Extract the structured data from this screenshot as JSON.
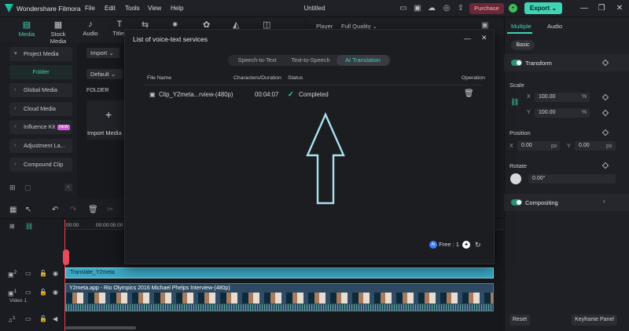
{
  "app": {
    "name": "Wondershare Filmora",
    "menu": [
      "File",
      "Edit",
      "Tools",
      "View",
      "Help"
    ],
    "project_title": "Untitled",
    "purchase_label": "Purchase",
    "export_label": "Export"
  },
  "toolbar": {
    "tabs": [
      {
        "label": "Media",
        "icon": "media-icon",
        "active": true
      },
      {
        "label": "Stock Media",
        "icon": "stock-media-icon"
      },
      {
        "label": "Audio",
        "icon": "music-note-icon"
      },
      {
        "label": "Titles",
        "icon": "titles-icon"
      }
    ]
  },
  "sidebar": {
    "items": [
      {
        "label": "Project Media"
      },
      {
        "label": "Folder"
      },
      {
        "label": "Global Media"
      },
      {
        "label": "Cloud Media"
      },
      {
        "label": "Influence Kit",
        "badge": "NEW"
      },
      {
        "label": "Adjustment La..."
      },
      {
        "label": "Compound Clip"
      }
    ]
  },
  "media": {
    "import_label": "Import",
    "default_label": "Default",
    "folder_label": "FOLDER",
    "import_media_label": "Import Media"
  },
  "player": {
    "label": "Player",
    "quality": "Full Quality"
  },
  "dialog": {
    "title": "List of voice-text services",
    "tabs": [
      "Speech-to-Text",
      "Text-to-Speech",
      "AI Translation"
    ],
    "active_tab": "AI Translation",
    "columns": [
      "File Name",
      "Characters/Duration",
      "Status",
      "Operation"
    ],
    "rows": [
      {
        "file_name": "Clip_Y2meta...rview-(480p)",
        "duration": "00:04:07",
        "status": "Completed"
      }
    ],
    "free_label": "Free : 1",
    "ai_badge": "AI"
  },
  "properties": {
    "tabs": [
      "Multiple",
      "Audio"
    ],
    "active_tab": "Multiple",
    "basic_label": "Basic",
    "transform_label": "Transform",
    "scale_label": "Scale",
    "scale_x": "100.00",
    "scale_y": "100.00",
    "percent": "%",
    "position_label": "Position",
    "pos_x": "0.00",
    "pos_y": "0.00",
    "px": "px",
    "rotate_label": "Rotate",
    "rotate_value": "0.00°",
    "compositing_label": "Compositing",
    "x": "X",
    "y": "Y",
    "reset_label": "Reset",
    "keyframe_label": "Keyframe Panel"
  },
  "timeline": {
    "ruler": [
      "00:00",
      "00:00:05:00"
    ],
    "track2_index": "2",
    "track1_index": "1",
    "video_track_label": "Video 1",
    "audio_track_index": "1",
    "title_clip": "Translate_Y2meta",
    "video_clip": "Y2meta.app - Rio Olympics 2016 Michael Phelps Interview-(480p)"
  },
  "colors": {
    "accent": "#3ed4b4",
    "purchase_bg": "#6b2837",
    "title_clip": "#3da7c4",
    "video_clip": "#2e4a63",
    "playhead": "#e64b5c"
  }
}
